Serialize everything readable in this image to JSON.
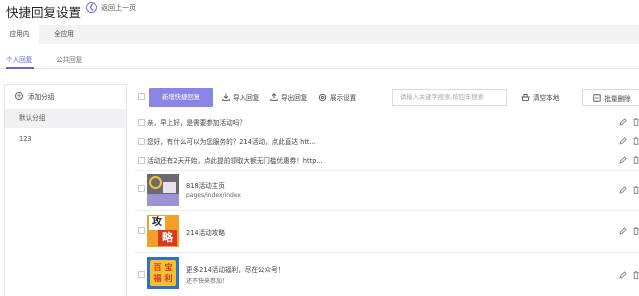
{
  "header": {
    "title": "快捷回复设置",
    "back_label": "返回上一页"
  },
  "scope_tabs": [
    {
      "label": "应用内",
      "active": true
    },
    {
      "label": "全应用",
      "active": false
    }
  ],
  "sub_tabs": [
    {
      "label": "个人回复",
      "active": true
    },
    {
      "label": "公共回复",
      "active": false
    }
  ],
  "sidebar": {
    "add_group_label": "添加分组",
    "groups": [
      {
        "label": "默认分组",
        "active": true
      },
      {
        "label": "123",
        "active": false
      }
    ]
  },
  "toolbar": {
    "new_reply_label": "新增快捷回复",
    "import_label": "导入回复",
    "export_label": "导出回复",
    "display_settings_label": "展示设置",
    "search_placeholder": "请输入关键字搜索,按回车搜索",
    "clear_local_label": "清空本地",
    "bulk_delete_label": "批量删除"
  },
  "replies": [
    {
      "text": "亲，早上好，是需要参加活动吗？"
    },
    {
      "text": "您好，有什么可以为您服务的？214活动，点此直达 htt..."
    },
    {
      "text": "活动还有2天开始，点此提前领取大额无门槛优惠券！http..."
    }
  ],
  "cards": [
    {
      "title": "818活动主页",
      "subtitle": "pages/index/index",
      "thumb": "activity-page"
    },
    {
      "title": "214活动攻略",
      "subtitle": "",
      "thumb": "strategy",
      "thumb_text": [
        "攻",
        "略"
      ]
    },
    {
      "title": "更多214活动福利，尽在公众号！",
      "subtitle": "还不快来参加！",
      "thumb": "official-account",
      "thumb_text": [
        "百",
        "宝",
        "福",
        "利"
      ]
    }
  ],
  "colors": {
    "accent": "#6964d3",
    "primary_button": "#8a84e6"
  }
}
